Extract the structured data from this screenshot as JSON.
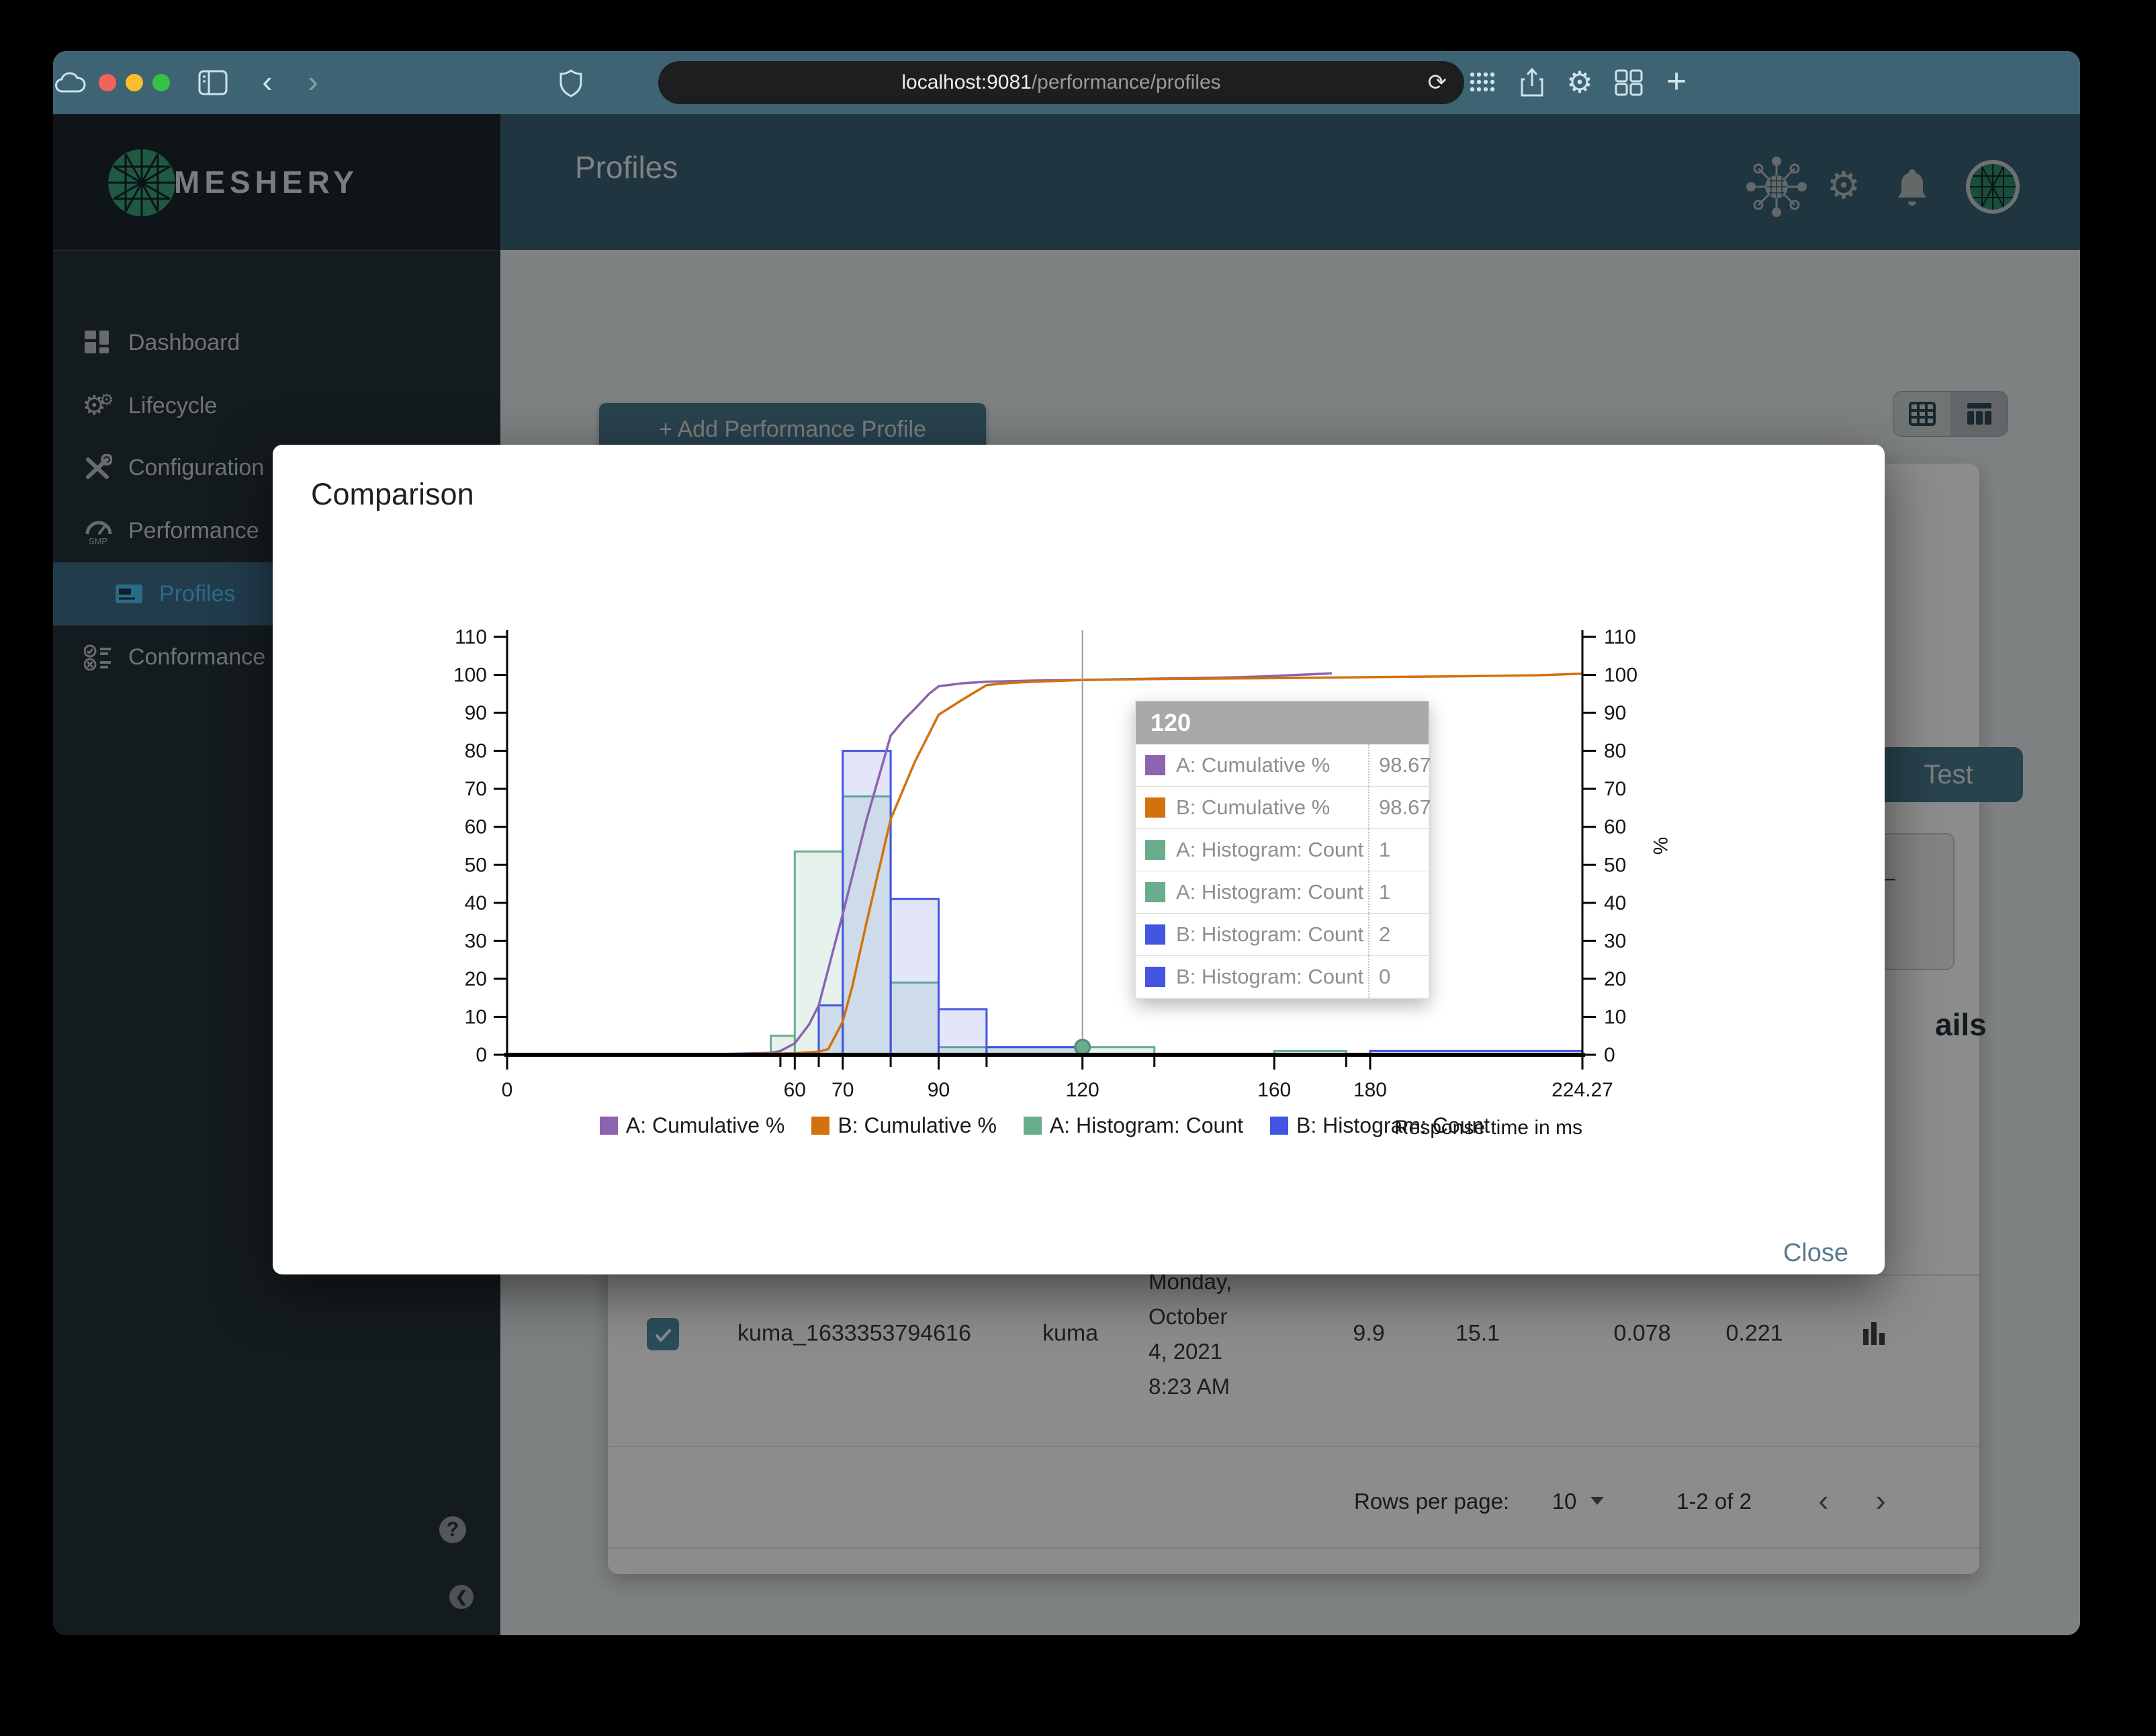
{
  "browser": {
    "url_host": "localhost:9081",
    "url_path": "/performance/profiles",
    "reload_icon": "⟳",
    "back_icon": "‹",
    "forward_icon": "›",
    "plus_icon": "+"
  },
  "sidebar": {
    "brand": "MESHERY",
    "items": [
      {
        "label": "Dashboard"
      },
      {
        "label": "Lifecycle"
      },
      {
        "label": "Configuration"
      },
      {
        "label": "Performance"
      },
      {
        "label": "Profiles",
        "selected": true
      },
      {
        "label": "Conformance"
      }
    ],
    "help_glyph": "?",
    "collapse_glyph": "❮"
  },
  "header": {
    "title": "Profiles"
  },
  "content": {
    "add_button": "+ Add Performance Profile",
    "test_button": "Test",
    "details_cut_text": "ails",
    "back_arrow": "←",
    "row": {
      "name": "kuma_1633353794616",
      "mesh": "kuma",
      "date_lines": [
        "Monday,",
        "October",
        "4, 2021",
        "8:23 AM"
      ],
      "qps": "9.9",
      "duration": "15.1",
      "p50": "0.078",
      "p99": "0.221"
    },
    "pagination": {
      "rows_per_page_label": "Rows per page:",
      "rows_per_page_value": "10",
      "range": "1-2 of 2",
      "prev_icon": "‹",
      "next_icon": "›"
    }
  },
  "modal": {
    "title": "Comparison",
    "close_label": "Close"
  },
  "colors": {
    "accent_teal": "#3e6474",
    "sidebar_selected_text": "#4fc3f7",
    "brand_green": "#3aa07a",
    "series_a_line": "#8c63b0",
    "series_b_line": "#d2710d",
    "series_a_hist": "#69ad8d",
    "series_b_hist": "#4355e0"
  },
  "chart_data": {
    "type": "histogram+cumulative-line",
    "xlabel": "Response time in ms",
    "right_axis_label": "%",
    "xlim": [
      0,
      224.27
    ],
    "ylim": [
      0,
      110
    ],
    "y_ticks": [
      0,
      10,
      20,
      30,
      40,
      50,
      60,
      70,
      80,
      90,
      100,
      110
    ],
    "x_major_ticks": [
      0,
      60,
      70,
      90,
      120,
      160,
      180,
      224.27
    ],
    "x_major_labels": [
      "0",
      "60",
      "70",
      "90",
      "120",
      "160",
      "180",
      "224.27"
    ],
    "x_minor_ticks": [
      57,
      65,
      80,
      100,
      135,
      175
    ],
    "grid": false,
    "legend_position": "bottom",
    "series": [
      {
        "name": "A: Cumulative %",
        "type": "line",
        "color": "#8c63b0",
        "points": [
          [
            0,
            0.2
          ],
          [
            45,
            0.2
          ],
          [
            55,
            0.5
          ],
          [
            57,
            1
          ],
          [
            60,
            3
          ],
          [
            63,
            8
          ],
          [
            65,
            13
          ],
          [
            70,
            37
          ],
          [
            75,
            62
          ],
          [
            80,
            84
          ],
          [
            83,
            88.5
          ],
          [
            85,
            91
          ],
          [
            88,
            95
          ],
          [
            90,
            97
          ],
          [
            95,
            97.8
          ],
          [
            100,
            98.2
          ],
          [
            110,
            98.5
          ],
          [
            120,
            98.67
          ],
          [
            130,
            98.9
          ],
          [
            140,
            99.1
          ],
          [
            150,
            99.3
          ],
          [
            158,
            99.6
          ],
          [
            165,
            100
          ],
          [
            172,
            100.4
          ]
        ]
      },
      {
        "name": "B: Cumulative %",
        "type": "line",
        "color": "#d2710d",
        "points": [
          [
            0,
            0
          ],
          [
            50,
            0.2
          ],
          [
            60,
            0.4
          ],
          [
            65,
            0.8
          ],
          [
            67,
            1.5
          ],
          [
            70,
            8.7
          ],
          [
            72,
            18
          ],
          [
            75,
            35
          ],
          [
            80,
            62
          ],
          [
            85,
            77
          ],
          [
            90,
            89.5
          ],
          [
            95,
            93.5
          ],
          [
            100,
            97.3
          ],
          [
            105,
            97.9
          ],
          [
            110,
            98.2
          ],
          [
            120,
            98.67
          ],
          [
            135,
            98.9
          ],
          [
            150,
            99.05
          ],
          [
            160,
            99.15
          ],
          [
            180,
            99.4
          ],
          [
            200,
            99.65
          ],
          [
            215,
            99.9
          ],
          [
            224.27,
            100.3
          ]
        ]
      },
      {
        "name": "A: Histogram: Count",
        "type": "bars",
        "color": "#69ad8d",
        "fill": "rgba(105,173,141,0.16)",
        "bars": [
          [
            55,
            60,
            5
          ],
          [
            60,
            70,
            53.5
          ],
          [
            70,
            80,
            68
          ],
          [
            80,
            90,
            19
          ],
          [
            90,
            135,
            2
          ],
          [
            160,
            175,
            1
          ]
        ]
      },
      {
        "name": "B: Histogram: Count",
        "type": "bars",
        "color": "#4355e0",
        "fill": "rgba(67,85,224,0.15)",
        "bars": [
          [
            65,
            70,
            13
          ],
          [
            70,
            80,
            80
          ],
          [
            80,
            90,
            41
          ],
          [
            90,
            100,
            12
          ],
          [
            100,
            120,
            2
          ],
          [
            180,
            224.27,
            1
          ]
        ]
      }
    ],
    "crosshair_x": 120,
    "marker": {
      "x": 120,
      "y": 2,
      "color": "#69ad8d",
      "edge": "#4e8d70"
    },
    "tooltip": {
      "title": "120",
      "rows": [
        {
          "swatch": "#8c63b0",
          "label": "A: Cumulative %",
          "value": "98.67"
        },
        {
          "swatch": "#d2710d",
          "label": "B: Cumulative %",
          "value": "98.67"
        },
        {
          "swatch": "#69ad8d",
          "label": "A: Histogram: Count",
          "value": "1"
        },
        {
          "swatch": "#69ad8d",
          "label": "A: Histogram: Count",
          "value": "1"
        },
        {
          "swatch": "#4355e0",
          "label": "B: Histogram: Count",
          "value": "2"
        },
        {
          "swatch": "#4355e0",
          "label": "B: Histogram: Count",
          "value": "0"
        }
      ]
    }
  }
}
